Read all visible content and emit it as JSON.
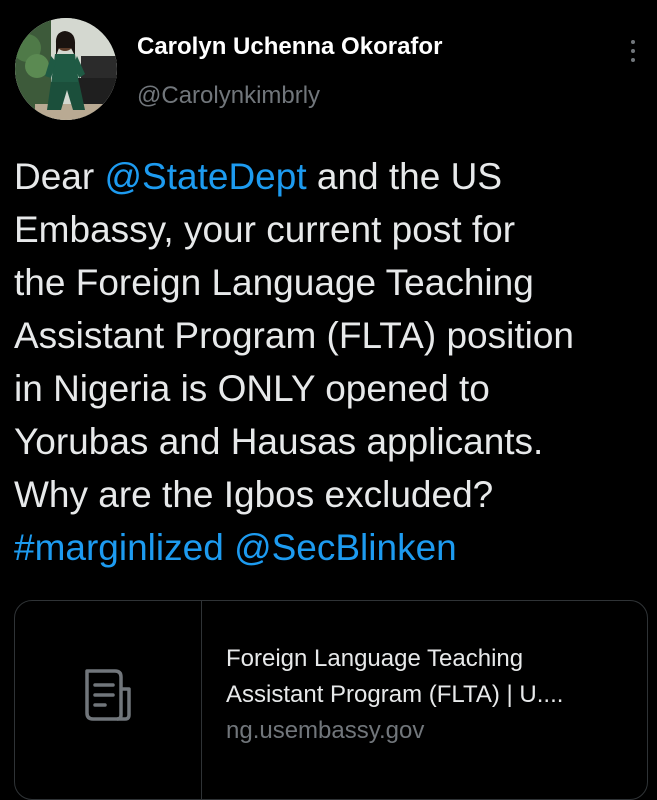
{
  "author": {
    "name": "Carolyn Uchenna Okorafor",
    "handle": "@Carolynkimbrly"
  },
  "tweet": {
    "lines": [
      [
        {
          "text": "Dear ",
          "link": false
        },
        {
          "text": "@StateDept",
          "link": true
        },
        {
          "text": " and the US",
          "link": false
        }
      ],
      [
        {
          "text": "Embassy, your current post for",
          "link": false
        }
      ],
      [
        {
          "text": "the Foreign Language Teaching",
          "link": false
        }
      ],
      [
        {
          "text": "Assistant Program (FLTA) position",
          "link": false
        }
      ],
      [
        {
          "text": "in Nigeria is ONLY opened to",
          "link": false
        }
      ],
      [
        {
          "text": "Yorubas and Hausas applicants.",
          "link": false
        }
      ],
      [
        {
          "text": "Why are the Igbos excluded?",
          "link": false
        }
      ],
      [
        {
          "text": "#marginlized",
          "link": true
        },
        {
          "text": " ",
          "link": false
        },
        {
          "text": "@SecBlinken",
          "link": true
        }
      ]
    ]
  },
  "card": {
    "icon": "document-icon",
    "title_lines": [
      "Foreign Language Teaching",
      "Assistant Program (FLTA) | U...."
    ],
    "domain": "ng.usembassy.gov"
  },
  "colors": {
    "background": "#000000",
    "text": "#e7e9ea",
    "secondary": "#71767b",
    "link": "#1d9bf0",
    "border": "#2f3336"
  },
  "icons": {
    "more": "more-vertical-icon",
    "card": "document-icon"
  }
}
